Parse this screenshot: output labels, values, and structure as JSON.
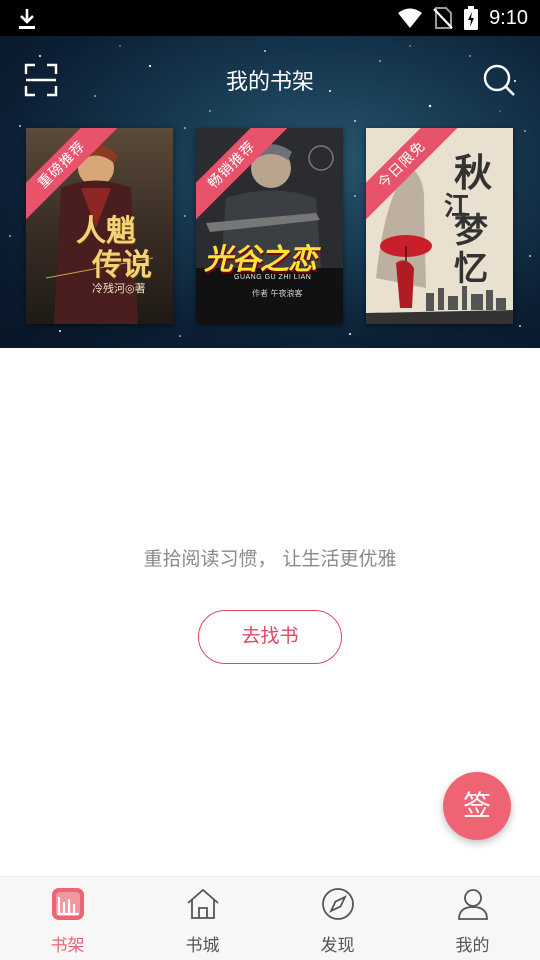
{
  "status_bar": {
    "time": "9:10"
  },
  "header": {
    "title": "我的书架"
  },
  "featured_books": [
    {
      "ribbon": "重磅推荐",
      "title_line1": "人魈",
      "title_line2": "传说",
      "author": "冷残河◎著"
    },
    {
      "ribbon": "畅销推荐",
      "title": "光谷之恋",
      "subtitle": "GUANG GU ZHI LIAN",
      "author": "作者 午夜浪客"
    },
    {
      "ribbon": "今日限免",
      "title_line1": "秋",
      "title_line2": "江",
      "title_line3": "梦忆"
    }
  ],
  "empty_state": {
    "message": "重拾阅读习惯， 让生活更优雅",
    "button_label": "去找书"
  },
  "sign_button": {
    "label": "签"
  },
  "tabs": [
    {
      "label": "书架",
      "icon": "bookshelf-icon",
      "active": true
    },
    {
      "label": "书城",
      "icon": "home-icon",
      "active": false
    },
    {
      "label": "发现",
      "icon": "compass-icon",
      "active": false
    },
    {
      "label": "我的",
      "icon": "user-icon",
      "active": false
    }
  ],
  "colors": {
    "accent": "#ef6474",
    "button_border": "#e0485e",
    "ribbon": "#e8536b"
  }
}
